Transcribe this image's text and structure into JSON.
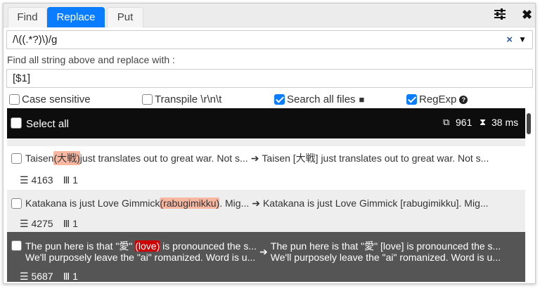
{
  "tabs": [
    {
      "label": "Find",
      "active": false
    },
    {
      "label": "Replace",
      "active": true
    },
    {
      "label": "Put",
      "active": false
    }
  ],
  "toolbar": {
    "settings_icon": "sliders-icon",
    "close_icon": "close-icon"
  },
  "search": {
    "value": "/\\((.*?)\\)/g",
    "clear": "×",
    "dropdown": "▼"
  },
  "replace": {
    "label": "Find all string above and replace with :",
    "value": "[$1]"
  },
  "options": [
    {
      "label": "Case sensitive",
      "checked": false
    },
    {
      "label": "Transpile \\r\\n\\t",
      "checked": false
    },
    {
      "label": "Search all files",
      "checked": true
    },
    {
      "label": "RegExp",
      "checked": true
    }
  ],
  "results_header": {
    "select_all": "Select all",
    "count": "961",
    "time": "38 ms"
  },
  "results": [
    {
      "before": "Taisen ",
      "match": "(大戦)",
      "after": " just translates out to great war.  Not s...",
      "replaced": "Taisen [大戦] just translates out to great war.  Not s...",
      "line": "4163",
      "col": "1"
    },
    {
      "before": "Katakana is just Love Gimmick ",
      "match": "(rabugimikku)",
      "after": ".  Mig...",
      "replaced": "Katakana is just Love Gimmick [rabugimikku].  Mig...",
      "line": "4275",
      "col": "1"
    },
    {
      "before": "The pun here is that \"愛\" ",
      "match": "(love)",
      "after": " is pronounced the s...",
      "before2": "We'll purposely leave the \"ai\" romanized. Word is u...",
      "replaced": "The pun here is that \"愛\" [love] is pronounced the s...",
      "replaced2": "We'll purposely leave the \"ai\" romanized. Word is u...",
      "line": "5687",
      "col": "1",
      "selected": true
    }
  ],
  "colors": {
    "accent": "#0a7cff",
    "match_bg": "#f8b7a0",
    "selected_match_bg": "#cc0000",
    "selected_row": "#555555"
  }
}
